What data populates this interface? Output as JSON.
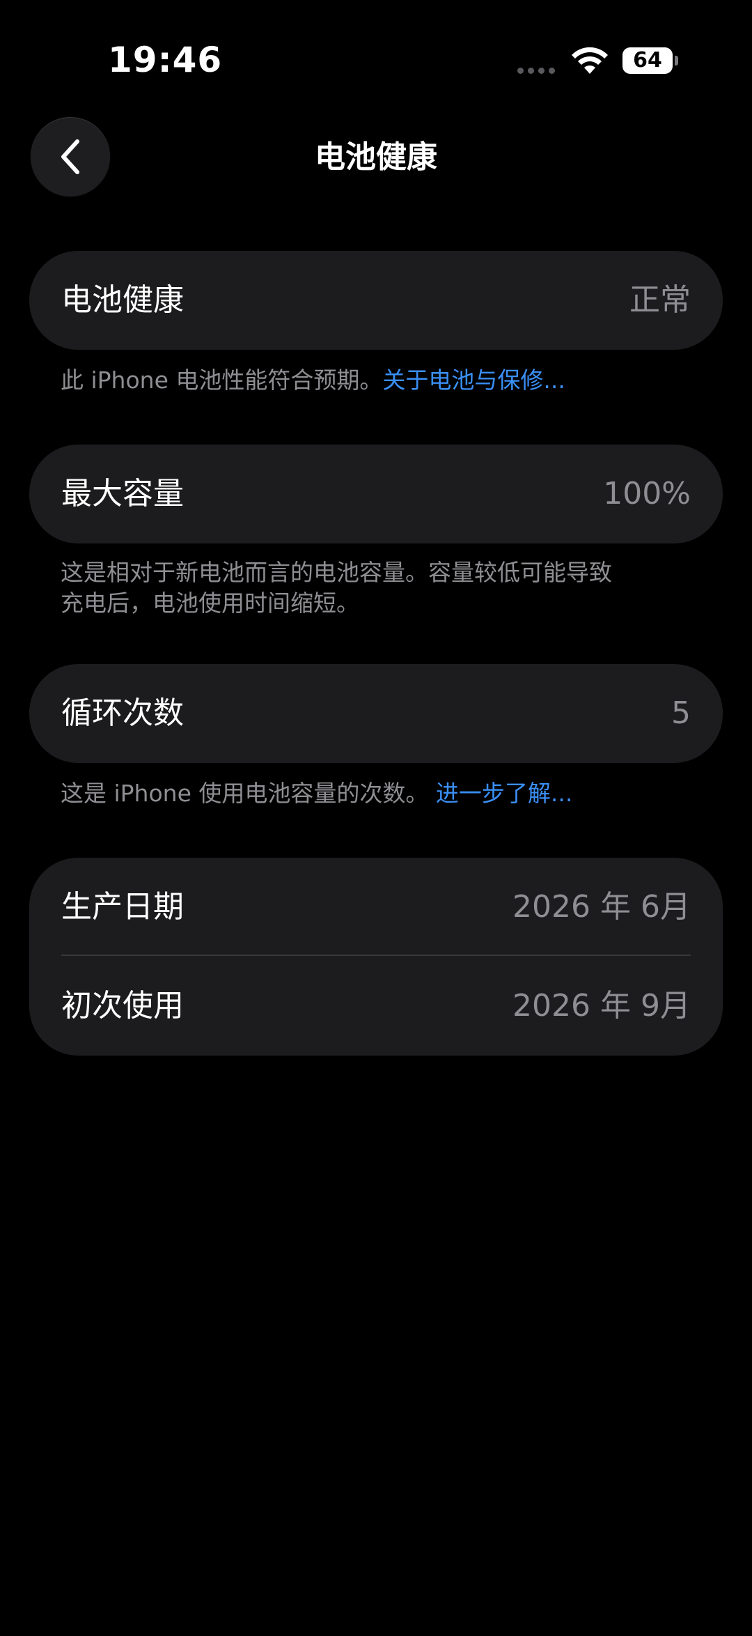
{
  "status_bar": {
    "time": "19:46",
    "battery_level": "64",
    "wifi_icon": "wifi-icon",
    "signal_icon": "cellular-dots-icon"
  },
  "nav": {
    "back_icon": "chevron-left-icon",
    "title": "电池健康"
  },
  "battery_health": {
    "label": "电池健康",
    "value": "正常",
    "note": "此 iPhone 电池性能符合预期。",
    "note_link": "关于电池与保修..."
  },
  "max_capacity": {
    "label": "最大容量",
    "value": "100%",
    "note_line1": "这是相对于新电池而言的电池容量。容量较低可能导致",
    "note_line2": "充电后，电池使用时间缩短。"
  },
  "cycle_count": {
    "label": "循环次数",
    "value": "5",
    "note": "这是 iPhone 使用电池容量的次数。",
    "note_link": "进一步了解..."
  },
  "dates": {
    "manufacture_label": "生产日期",
    "manufacture_value": "2026 年 6月",
    "first_use_label": "初次使用",
    "first_use_value": "2026 年 9月"
  },
  "colors": {
    "background": "#000000",
    "card": "#1c1c1e",
    "secondary_text": "#8e8e93",
    "link": "#3a8ff5"
  }
}
